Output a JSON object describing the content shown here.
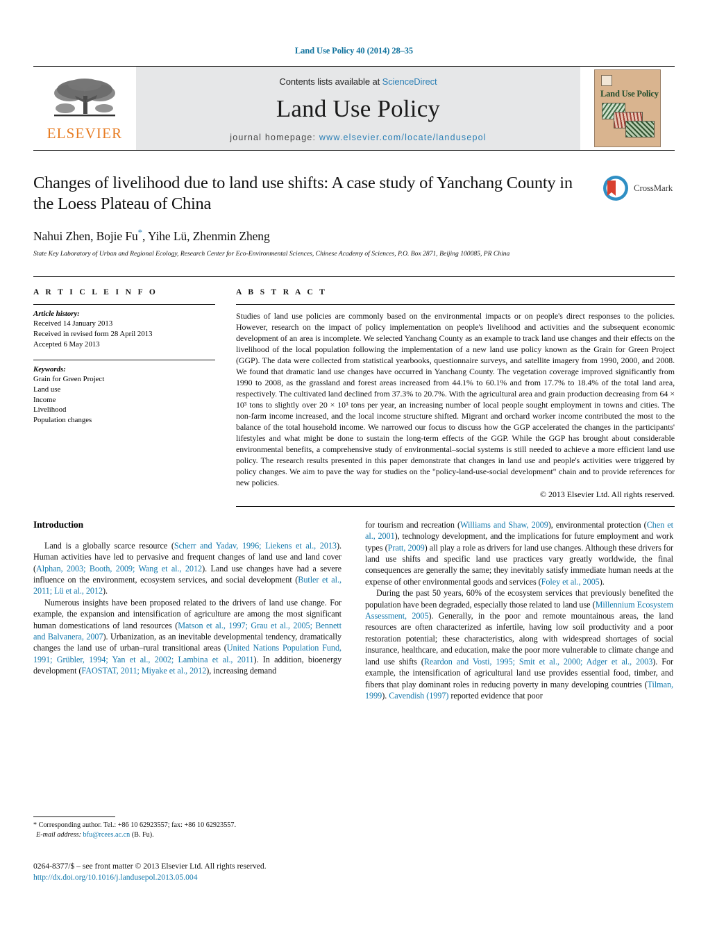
{
  "running_head": "Land Use Policy 40 (2014) 28–35",
  "masthead": {
    "publisher_name": "ELSEVIER",
    "contents_prefix": "Contents lists available at ",
    "contents_link": "ScienceDirect",
    "journal_title": "Land Use Policy",
    "homepage_prefix": "journal homepage: ",
    "homepage_url": "www.elsevier.com/locate/landusepol",
    "cover_title": "Land Use Policy"
  },
  "article": {
    "title": "Changes of livelihood due to land use shifts: A case study of Yanchang County in the Loess Plateau of China",
    "authors": "Nahui Zhen, Bojie Fu",
    "authors_rest": ", Yihe Lü, Zhenmin Zheng",
    "corresponding_marker": "*",
    "affiliation": "State Key Laboratory of Urban and Regional Ecology, Research Center for Eco-Environmental Sciences, Chinese Academy of Sciences, P.O. Box 2871, Beijing 100085, PR China",
    "crossmark_label": "CrossMark"
  },
  "article_info": {
    "heading": "A R T I C L E    I N F O",
    "history_label": "Article history:",
    "history": [
      "Received 14 January 2013",
      "Received in revised form 28 April 2013",
      "Accepted 6 May 2013"
    ],
    "keywords_label": "Keywords:",
    "keywords": [
      "Grain for Green Project",
      "Land use",
      "Income",
      "Livelihood",
      "Population changes"
    ]
  },
  "abstract": {
    "heading": "A B S T R A C T",
    "text": "Studies of land use policies are commonly based on the environmental impacts or on people's direct responses to the policies. However, research on the impact of policy implementation on people's livelihood and activities and the subsequent economic development of an area is incomplete. We selected Yanchang County as an example to track land use changes and their effects on the livelihood of the local population following the implementation of a new land use policy known as the Grain for Green Project (GGP). The data were collected from statistical yearbooks, questionnaire surveys, and satellite imagery from 1990, 2000, and 2008. We found that dramatic land use changes have occurred in Yanchang County. The vegetation coverage improved significantly from 1990 to 2008, as the grassland and forest areas increased from 44.1% to 60.1% and from 17.7% to 18.4% of the total land area, respectively. The cultivated land declined from 37.3% to 20.7%. With the agricultural area and grain production decreasing from 64 × 10³ tons to slightly over 20 × 10³ tons per year, an increasing number of local people sought employment in towns and cities. The non-farm income increased, and the local income structure shifted. Migrant and orchard worker income contributed the most to the balance of the total household income. We narrowed our focus to discuss how the GGP accelerated the changes in the participants' lifestyles and what might be done to sustain the long-term effects of the GGP. While the GGP has brought about considerable environmental benefits, a comprehensive study of environmental–social systems is still needed to achieve a more efficient land use policy. The research results presented in this paper demonstrate that changes in land use and people's activities were triggered by policy changes. We aim to pave the way for studies on the \"policy-land-use-social development\" chain and to provide references for new policies.",
    "copyright": "© 2013 Elsevier Ltd. All rights reserved."
  },
  "introduction": {
    "heading": "Introduction",
    "left_paragraphs": [
      {
        "segments": [
          {
            "t": "Land is a globally scarce resource (",
            "c": false
          },
          {
            "t": "Scherr and Yadav, 1996; Liekens et al., 2013",
            "c": true
          },
          {
            "t": "). Human activities have led to pervasive and frequent changes of land use and land cover (",
            "c": false
          },
          {
            "t": "Alphan, 2003; Booth, 2009; Wang et al., 2012",
            "c": true
          },
          {
            "t": "). Land use changes have had a severe influence on the environment, ecosystem services, and social development (",
            "c": false
          },
          {
            "t": "Butler et al., 2011; Lü et al., 2012",
            "c": true
          },
          {
            "t": ").",
            "c": false
          }
        ]
      },
      {
        "segments": [
          {
            "t": "Numerous insights have been proposed related to the drivers of land use change. For example, the expansion and intensification of agriculture are among the most significant human domestications of land resources (",
            "c": false
          },
          {
            "t": "Matson et al., 1997; Grau et al., 2005; Bennett and Balvanera, 2007",
            "c": true
          },
          {
            "t": "). Urbanization, as an inevitable developmental tendency, dramatically changes the land use of urban–rural transitional areas (",
            "c": false
          },
          {
            "t": "United Nations Population Fund, 1991; Grübler, 1994; Yan et al., 2002; Lambina et al., 2011",
            "c": true
          },
          {
            "t": "). In addition, bioenergy development (",
            "c": false
          },
          {
            "t": "FAOSTAT, 2011; Miyake et al., 2012",
            "c": true
          },
          {
            "t": "), increasing demand",
            "c": false
          }
        ]
      }
    ],
    "right_paragraphs": [
      {
        "segments": [
          {
            "t": "for tourism and recreation (",
            "c": false
          },
          {
            "t": "Williams and Shaw, 2009",
            "c": true
          },
          {
            "t": "), environmental protection (",
            "c": false
          },
          {
            "t": "Chen et al., 2001",
            "c": true
          },
          {
            "t": "), technology development, and the implications for future employment and work types (",
            "c": false
          },
          {
            "t": "Pratt, 2009",
            "c": true
          },
          {
            "t": ") all play a role as drivers for land use changes. Although these drivers for land use shifts and specific land use practices vary greatly worldwide, the final consequences are generally the same; they inevitably satisfy immediate human needs at the expense of other environmental goods and services (",
            "c": false
          },
          {
            "t": "Foley et al., 2005",
            "c": true
          },
          {
            "t": ").",
            "c": false
          }
        ]
      },
      {
        "segments": [
          {
            "t": "During the past 50 years, 60% of the ecosystem services that previously benefited the population have been degraded, especially those related to land use (",
            "c": false
          },
          {
            "t": "Millennium Ecosystem Assessment, 2005",
            "c": true
          },
          {
            "t": "). Generally, in the poor and remote mountainous areas, the land resources are often characterized as infertile, having low soil productivity and a poor restoration potential; these characteristics, along with widespread shortages of social insurance, healthcare, and education, make the poor more vulnerable to climate change and land use shifts (",
            "c": false
          },
          {
            "t": "Reardon and Vosti, 1995; Smit et al., 2000; Adger et al., 2003",
            "c": true
          },
          {
            "t": "). For example, the intensification of agricultural land use provides essential food, timber, and fibers that play dominant roles in reducing poverty in many developing countries (",
            "c": false
          },
          {
            "t": "Tilman, 1999",
            "c": true
          },
          {
            "t": "). ",
            "c": false
          },
          {
            "t": "Cavendish (1997)",
            "c": true
          },
          {
            "t": " reported evidence that poor",
            "c": false
          }
        ]
      }
    ]
  },
  "footnote": {
    "star": "*",
    "corresponding": "Corresponding author. Tel.: +86 10 62923557; fax: +86 10 62923557.",
    "email_label": "E-mail address:",
    "email": "bfu@rcees.ac.cn",
    "email_suffix": "(B. Fu)."
  },
  "footer": {
    "issn_line": "0264-8377/$ – see front matter © 2013 Elsevier Ltd. All rights reserved.",
    "doi": "http://dx.doi.org/10.1016/j.landusepol.2013.05.004"
  },
  "colors": {
    "link_blue": "#1177ab",
    "sciencedirect_blue": "#2b7fb5",
    "elsevier_orange": "#E77B21",
    "masthead_gray": "#e6e7e8",
    "cover_tan": "#d9b48f"
  }
}
